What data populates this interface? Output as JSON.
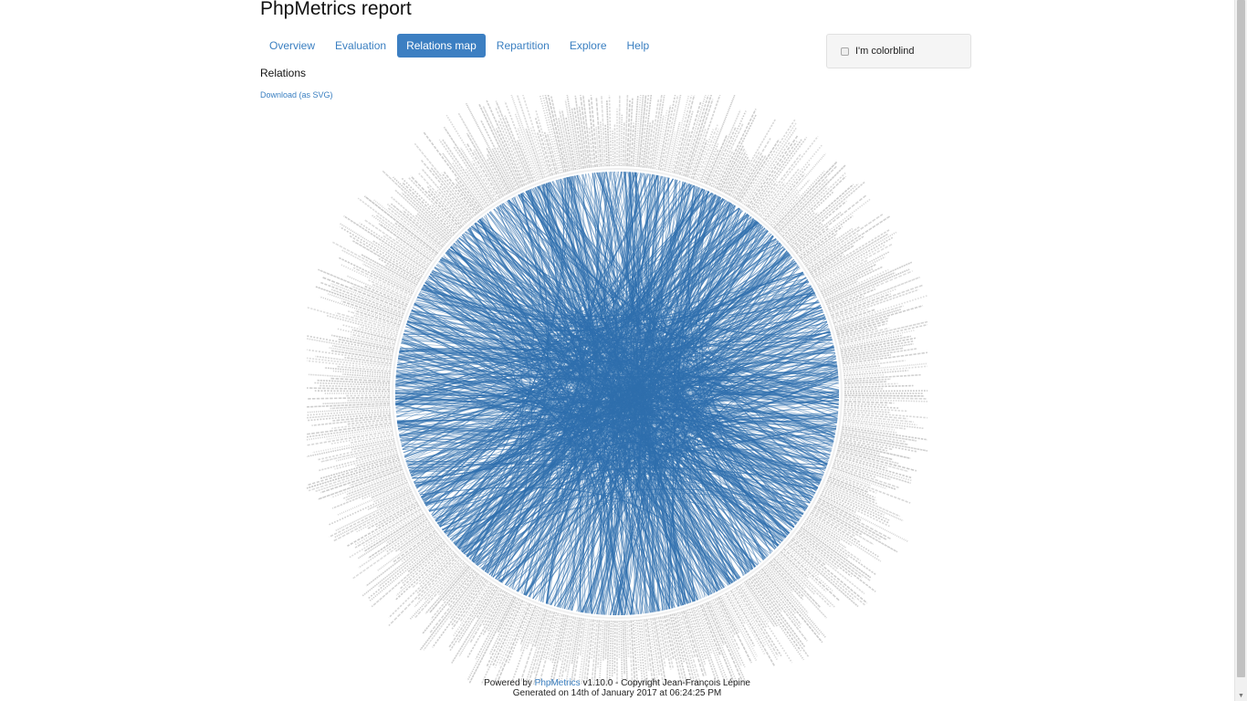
{
  "page": {
    "title": "PhpMetrics report"
  },
  "nav": {
    "tabs": [
      {
        "label": "Overview",
        "active": false
      },
      {
        "label": "Evaluation",
        "active": false
      },
      {
        "label": "Relations map",
        "active": true
      },
      {
        "label": "Repartition",
        "active": false
      },
      {
        "label": "Explore",
        "active": false
      },
      {
        "label": "Help",
        "active": false
      }
    ]
  },
  "colorblind": {
    "label": "I'm colorblind",
    "checked": false
  },
  "relations": {
    "heading": "Relations",
    "download_label": "Download (as SVG)"
  },
  "footer": {
    "powered_prefix": "Powered by",
    "product_link": "PhpMetrics",
    "version_copyright": "v1.10.0 - Copyright Jean-François Lépine",
    "generated": "Generated on 14th of January 2017 at 06:24:25 PM"
  },
  "colors": {
    "accent": "#3c7fc2",
    "link": "#3a7fc1",
    "edge": "#2f6fae",
    "label_gray": "#c4c4c4"
  }
}
